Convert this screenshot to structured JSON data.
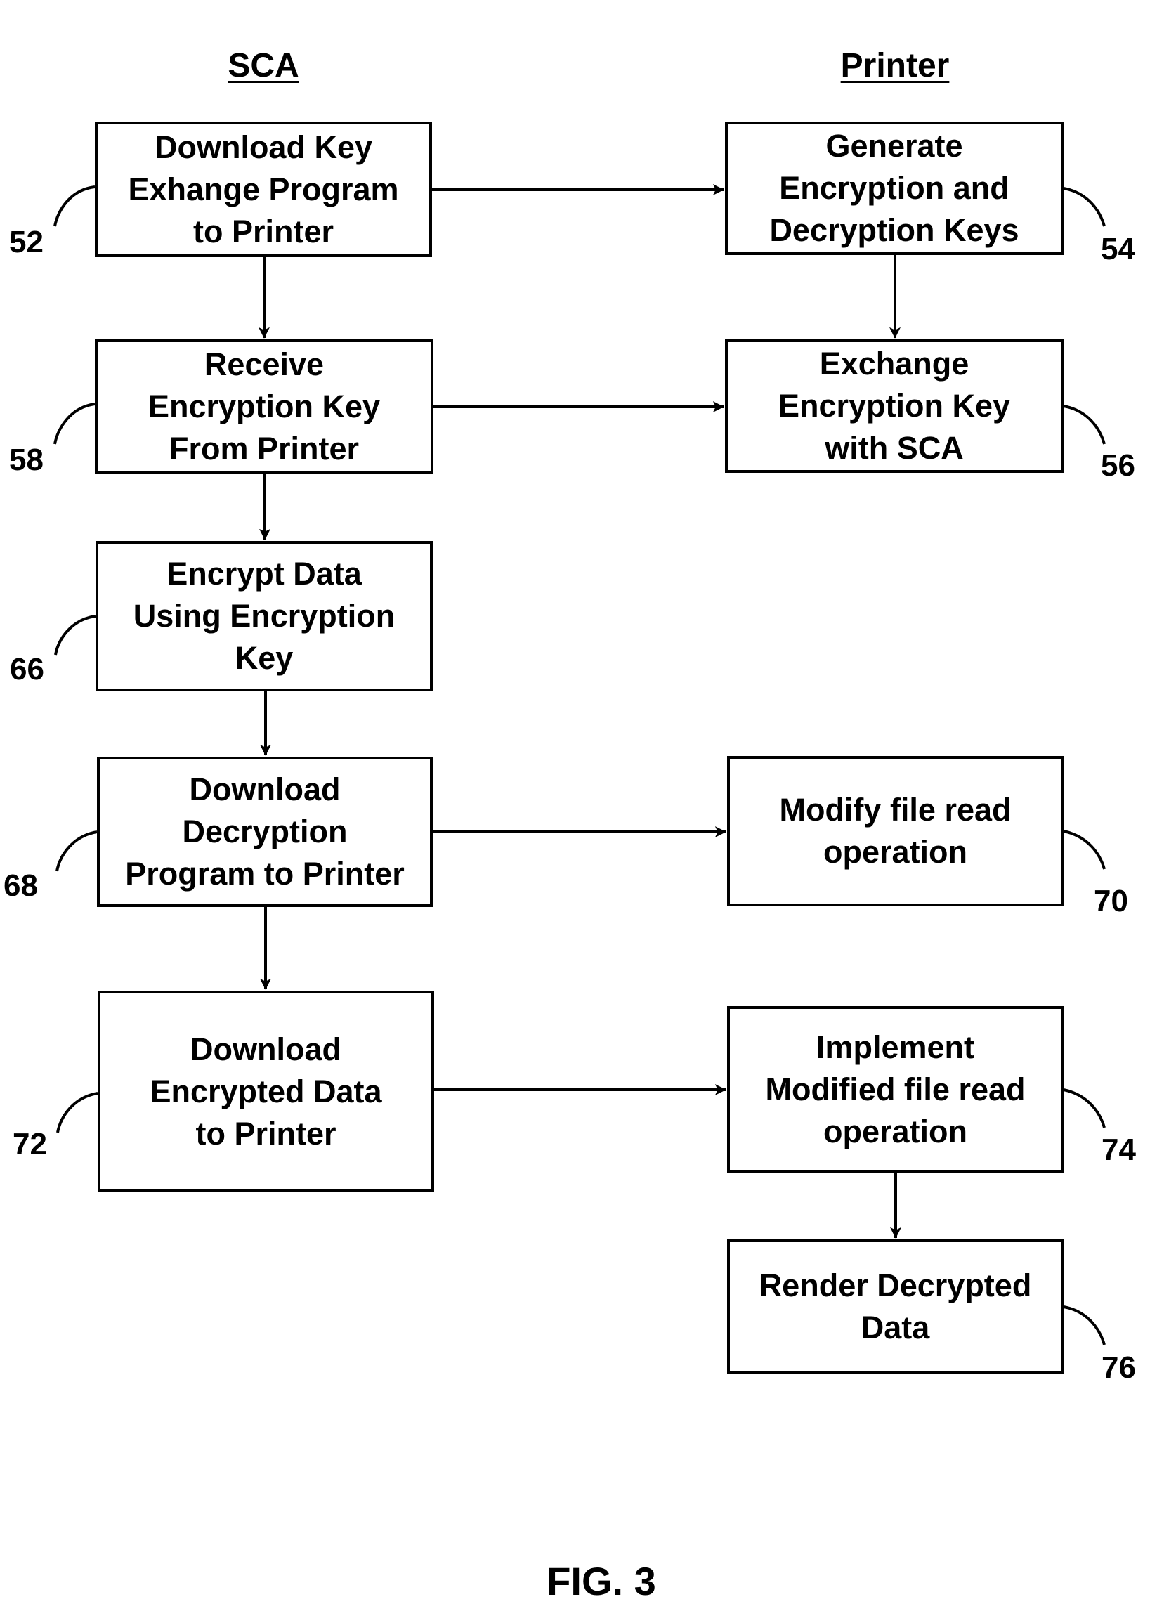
{
  "columns": {
    "sca": "SCA",
    "printer": "Printer"
  },
  "boxes": {
    "b52": {
      "ref": "52",
      "text": "Download Key\nExhange Program\nto Printer"
    },
    "b54": {
      "ref": "54",
      "text": "Generate\nEncryption and\nDecryption Keys"
    },
    "b58": {
      "ref": "58",
      "text": "Receive\nEncryption Key\nFrom Printer"
    },
    "b56": {
      "ref": "56",
      "text": "Exchange\nEncryption Key\nwith SCA"
    },
    "b66": {
      "ref": "66",
      "text": "Encrypt Data\nUsing Encryption\nKey"
    },
    "b68": {
      "ref": "68",
      "text": "Download\nDecryption\nProgram to Printer"
    },
    "b70": {
      "ref": "70",
      "text": "Modify file read\noperation"
    },
    "b72": {
      "ref": "72",
      "text": "Download\nEncrypted Data\nto Printer"
    },
    "b74": {
      "ref": "74",
      "text": "Implement\nModified file read\noperation"
    },
    "b76": {
      "ref": "76",
      "text": "Render Decrypted\nData"
    }
  },
  "connections": [
    {
      "from": "52",
      "to": "54",
      "type": "arrow"
    },
    {
      "from": "52",
      "to": "58",
      "type": "arrow"
    },
    {
      "from": "54",
      "to": "56",
      "type": "arrow"
    },
    {
      "from": "58",
      "to": "56",
      "type": "bidirectional"
    },
    {
      "from": "58",
      "to": "66",
      "type": "arrow"
    },
    {
      "from": "66",
      "to": "68",
      "type": "arrow"
    },
    {
      "from": "68",
      "to": "70",
      "type": "arrow"
    },
    {
      "from": "68",
      "to": "72",
      "type": "arrow"
    },
    {
      "from": "72",
      "to": "74",
      "type": "arrow"
    },
    {
      "from": "74",
      "to": "76",
      "type": "arrow"
    }
  ],
  "figure_label": "FIG. 3"
}
